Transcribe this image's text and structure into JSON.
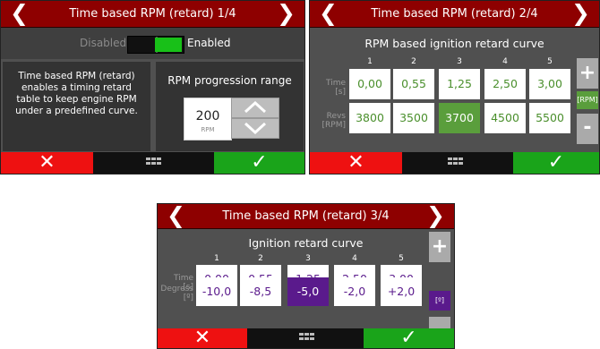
{
  "colors": {
    "header": "#8e0000",
    "cancel": "#ee1111",
    "confirm": "#1aa41a",
    "enabled": "#18c018",
    "screen2_accent": "#5a9e3c",
    "screen3_accent": "#5a1a8c"
  },
  "screen1": {
    "title": "Time based RPM (retard) 1/4",
    "disabled_label": "Disabled",
    "enabled_label": "Enabled",
    "toggle_state": "enabled",
    "description": "Time based RPM (retard) enables a timing retard table to keep engine RPM under a predefined curve.",
    "range_title": "RPM progression range",
    "range_value": "200",
    "range_unit": "RPM",
    "cancel_icon": "✕",
    "confirm_icon": "✓",
    "menu_icon": "grid-icon"
  },
  "screen2": {
    "title": "Time based RPM (retard) 2/4",
    "table_title": "RPM based ignition retard curve",
    "columns": [
      "1",
      "2",
      "3",
      "4",
      "5"
    ],
    "row1_label_a": "Time",
    "row1_label_b": "[s]",
    "row2_label_a": "Revs",
    "row2_label_b": "[RPM]",
    "time": [
      "0,00",
      "0,55",
      "1,25",
      "2,50",
      "3,00"
    ],
    "revs": [
      "3800",
      "3500",
      "3700",
      "4500",
      "5500"
    ],
    "selected_cell": "revs.3",
    "plus": "+",
    "minus": "-",
    "unit": "[RPM]",
    "cancel_icon": "✕",
    "confirm_icon": "✓"
  },
  "screen3": {
    "title": "Time based RPM (retard) 3/4",
    "table_title": "Ignition retard curve",
    "columns": [
      "1",
      "2",
      "3",
      "4",
      "5"
    ],
    "row1_label_a": "Time",
    "row1_label_b": "[s]",
    "row2_label_a": "Degress",
    "row2_label_b": "[º]",
    "time": [
      "0,00",
      "0,55",
      "1,25",
      "2,50",
      "3,00"
    ],
    "degrees": [
      "-10,0",
      "-8,5",
      "-5,0",
      "-2,0",
      "+2,0"
    ],
    "selected_cell": "degrees.3",
    "plus": "+",
    "minus": "-",
    "unit": "[º]",
    "cancel_icon": "✕",
    "confirm_icon": "✓"
  }
}
